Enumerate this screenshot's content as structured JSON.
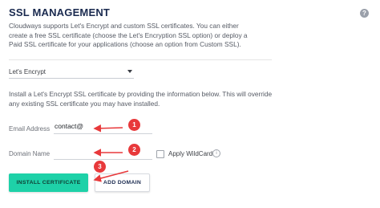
{
  "header": {
    "title": "SSL MANAGEMENT",
    "help_icon": "question-circle-icon",
    "help_glyph": "?"
  },
  "intro": {
    "text": "Cloudways supports Let's Encrypt and custom SSL certificates. You can either create a free SSL certificate (choose the Let's Encryption SSL option) or deploy a Paid SSL certificate for your applications (choose an option from Custom SSL)."
  },
  "cert_type_select": {
    "selected": "Let's Encrypt"
  },
  "instructions": {
    "text": "Install a Let's Encrypt SSL certificate by providing the information below. This will override any existing SSL certificate you may have installed."
  },
  "form": {
    "email_label": "Email Address",
    "email_value": "contact@",
    "domain_label": "Domain Name",
    "domain_value": "",
    "wildcard_label": "Apply WildCard",
    "wildcard_checked": false,
    "info_glyph": "i"
  },
  "buttons": {
    "install_label": "INSTALL CERTIFICATE",
    "add_domain_label": "ADD DOMAIN"
  },
  "annotations": {
    "badges": [
      "1",
      "2",
      "3"
    ],
    "color": "#e8393b"
  },
  "colors": {
    "title": "#1a2a4f",
    "accent": "#1ed1a8",
    "annotation": "#e8393b"
  }
}
